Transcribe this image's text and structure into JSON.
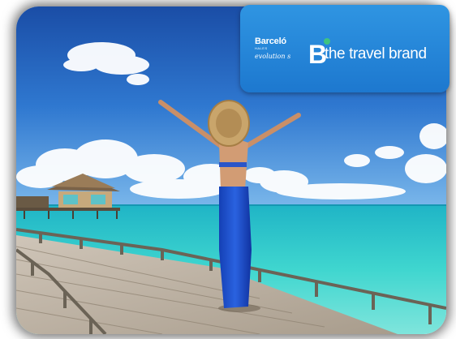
{
  "brand": {
    "barcelo_name": "Barceló",
    "barcelo_small": "HALES",
    "barcelo_tagline": "evolution s",
    "logo_mark": "B",
    "travel_brand": "the travel brand"
  },
  "colors": {
    "card_blue": "#1d78cf",
    "accent_green": "#3fc380",
    "sky_blue": "#1f5fb8",
    "sea_turquoise": "#27c3c4"
  },
  "icons": {
    "brand_mark": "travel-brand-b-icon"
  }
}
